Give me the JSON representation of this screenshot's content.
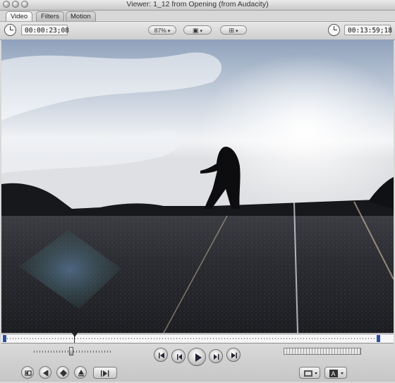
{
  "window": {
    "title": "Viewer: 1_12 from Opening (from Audacity)"
  },
  "tabs": [
    {
      "label": "Video",
      "active": true
    },
    {
      "label": "Filters",
      "active": false
    },
    {
      "label": "Motion",
      "active": false
    }
  ],
  "controls": {
    "timecode_duration": "00:00:23;08",
    "zoom": "87%",
    "view_options_icon": "view-mode-icon",
    "overlay_icon": "overlay-icon",
    "timecode_current": "00:13:59;18"
  },
  "transport": {
    "buttons": [
      "go-to-in-icon",
      "previous-edit-icon",
      "play-icon",
      "next-edit-icon",
      "go-to-out-icon"
    ],
    "left_buttons": [
      "mark-clip-icon",
      "mark-in-icon",
      "add-marker-icon",
      "mark-out-icon",
      "match-frame-icon"
    ],
    "right_buttons": [
      "recent-clips-icon",
      "generators-icon"
    ]
  },
  "colors": {
    "chrome": "#d8d8d8",
    "playhead": "#2a4da8"
  }
}
